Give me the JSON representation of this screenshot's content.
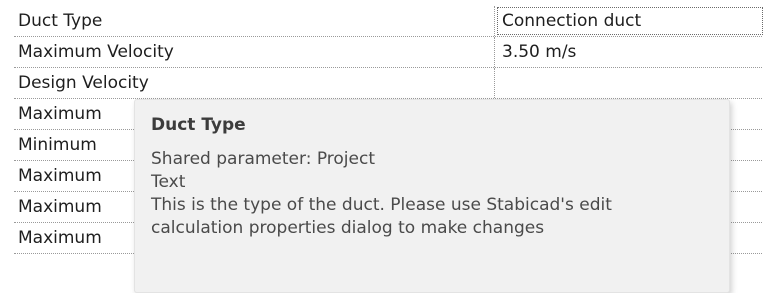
{
  "properties": {
    "rows": [
      {
        "name": "Duct Type",
        "value": "Connection duct"
      },
      {
        "name": "Maximum Velocity",
        "value": "3.50 m/s"
      },
      {
        "name": "Design Velocity",
        "value": ""
      },
      {
        "name": "Maximum",
        "value": ""
      },
      {
        "name": "Minimum",
        "value": ""
      },
      {
        "name": "Maximum",
        "value": ""
      },
      {
        "name": "Maximum",
        "value": ""
      },
      {
        "name": "Maximum",
        "value": ""
      }
    ]
  },
  "tooltip": {
    "title": "Duct Type",
    "lines": [
      "Shared parameter: Project",
      "Text",
      "This is the type of the duct. Please use Stabicad's edit",
      "calculation properties dialog to make changes"
    ]
  }
}
